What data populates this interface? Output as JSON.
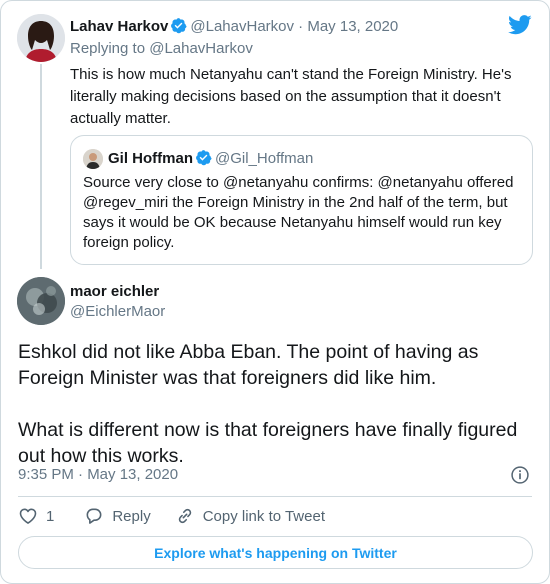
{
  "parent_tweet": {
    "author_name": "Lahav Harkov",
    "author_handle": "@LahavHarkov",
    "separator": "·",
    "date": "May 13, 2020",
    "replying_to": "Replying to @LahavHarkov",
    "text": "This is how much Netanyahu can't stand the Foreign Ministry. He's literally making decisions based on the assumption that it doesn't actually matter.",
    "quoted_tweet": {
      "author_name": "Gil Hoffman",
      "author_handle": "@Gil_Hoffman",
      "text": "Source very close to @netanyahu confirms: @netanyahu offered @regev_miri the Foreign Ministry in the 2nd half of the term, but says it would be OK because Netanyahu himself would run key foreign policy."
    }
  },
  "main_tweet": {
    "author_name": "maor eichler",
    "author_handle": "@EichlerMaor",
    "text": "Eshkol did not like Abba Eban. The point of having as Foreign Minister was that foreigners did like him.\n\nWhat is different now is that foreigners have finally figured out how this works.",
    "timestamp": "9:35 PM · May 13, 2020"
  },
  "actions": {
    "like_count": "1",
    "reply_label": "Reply",
    "copy_link_label": "Copy link to Tweet"
  },
  "explore_label": "Explore what's happening on Twitter",
  "colors": {
    "accent": "#1d9bf0",
    "verified": "#1d9bf0",
    "secondary_text": "#657786",
    "border": "#cfd9de"
  },
  "icons": [
    "twitter-bird-icon",
    "verified-badge-icon",
    "info-icon",
    "heart-icon",
    "reply-icon",
    "link-icon"
  ]
}
